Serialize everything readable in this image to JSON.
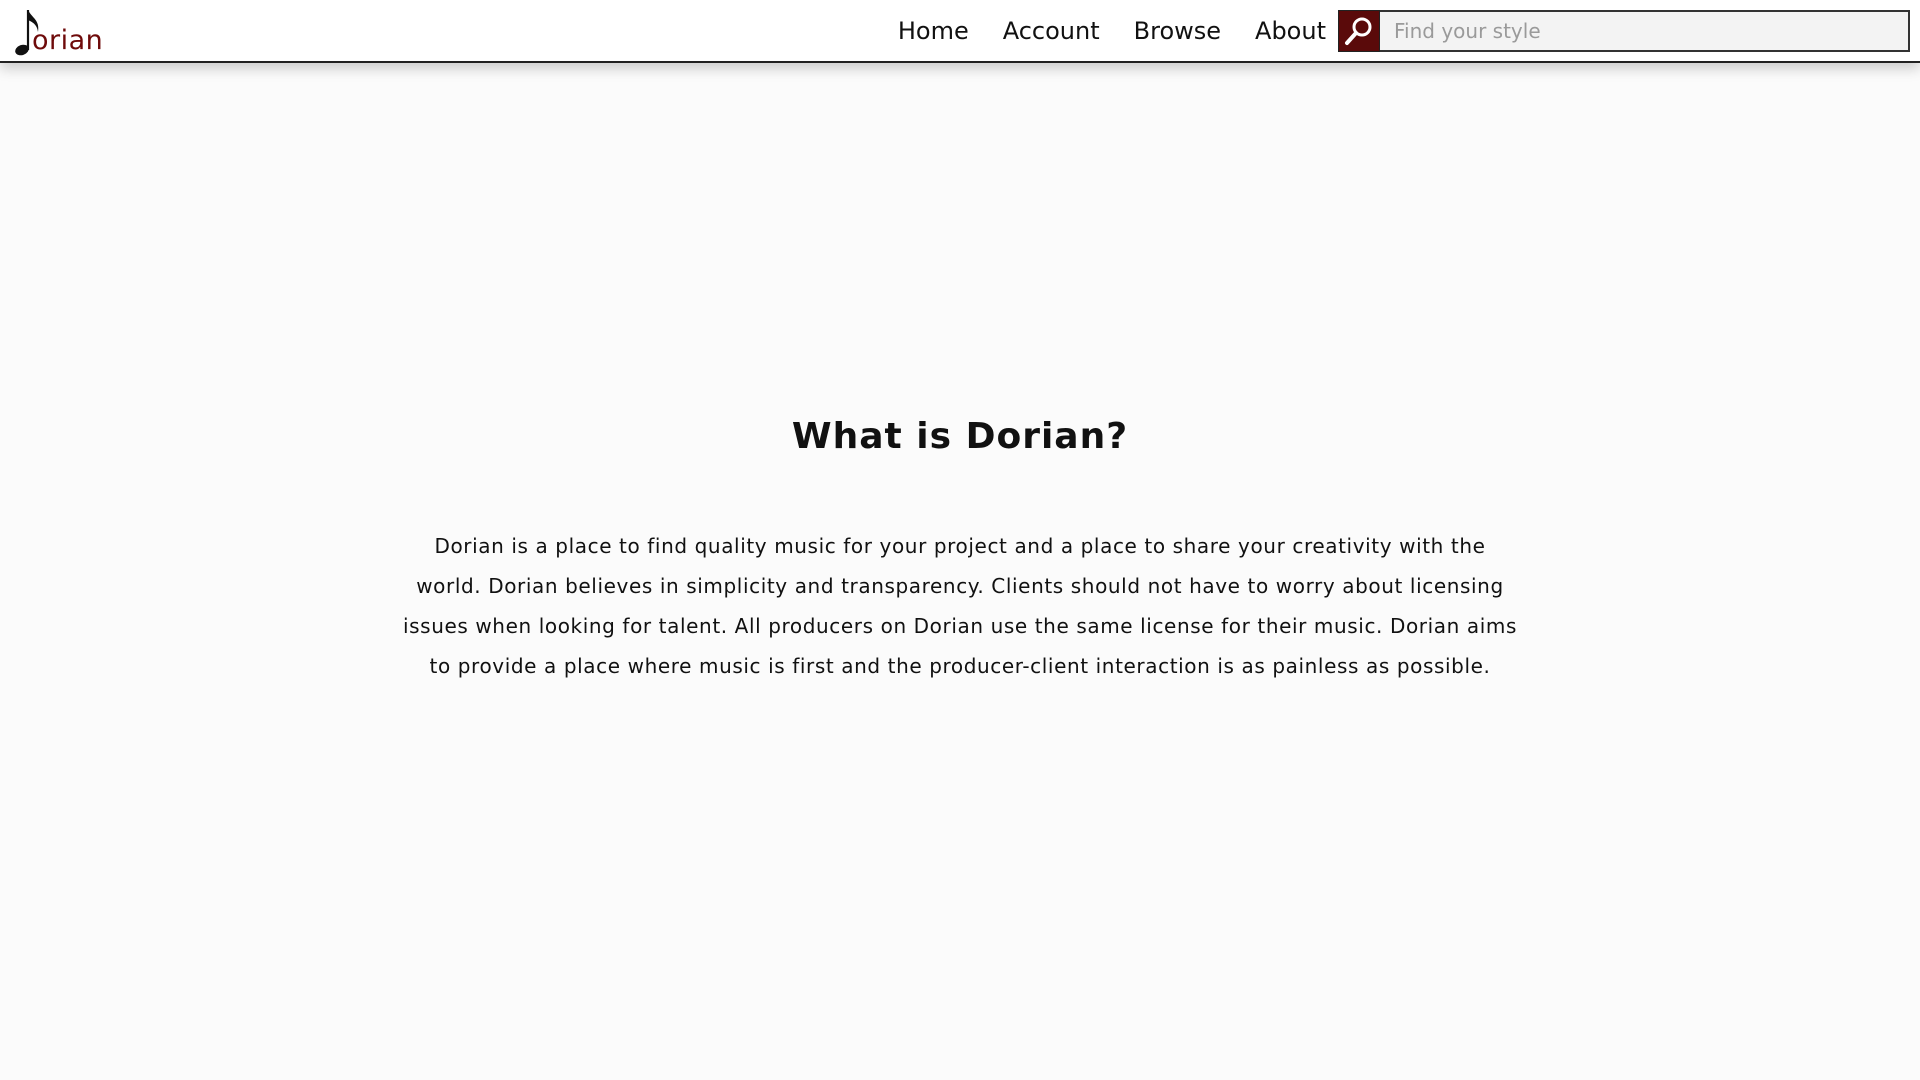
{
  "header": {
    "logo_text": "orian",
    "nav": {
      "home": "Home",
      "account": "Account",
      "browse": "Browse",
      "about": "About"
    },
    "search": {
      "placeholder": "Find your style",
      "value": ""
    },
    "colors": {
      "brand": "#6e0a0a",
      "search_button": "#5a0a0a"
    }
  },
  "main": {
    "title": "What is Dorian?",
    "body": "Dorian is a place to find quality music for your project and a place to share your creativity with the world. Dorian believes in simplicity and transparency. Clients should not have to worry about licensing issues when looking for talent. All producers on Dorian use the same license for their music. Dorian aims to provide a place where music is first and the producer-client interaction is as painless as possible."
  },
  "icons": {
    "logo": "music-note-icon",
    "search": "magnifier-icon"
  }
}
